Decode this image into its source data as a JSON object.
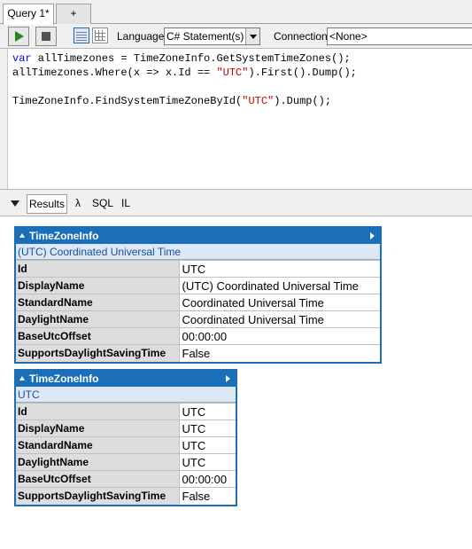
{
  "tabs": [
    {
      "label": "Query 1*",
      "active": true
    },
    {
      "label": "+"
    }
  ],
  "toolbar": {
    "run_icon": "play-icon",
    "stop_icon": "stop-icon",
    "language_label": "Language",
    "language_value": "C# Statement(s)",
    "connection_label": "Connection",
    "connection_value": "<None>"
  },
  "editor": {
    "lines": [
      "var allTimezones = TimeZoneInfo.GetSystemTimeZones();",
      "allTimezones.Where(x => x.Id == \"UTC\").First().Dump();",
      "",
      "TimeZoneInfo.FindSystemTimeZoneById(\"UTC\").Dump();"
    ]
  },
  "results_tabs": {
    "results": "Results",
    "lambda": "λ",
    "sql": "SQL",
    "il": "IL"
  },
  "dumps": [
    {
      "type": "TimeZoneInfo",
      "subtitle": "(UTC) Coordinated Universal Time",
      "rows": [
        {
          "key": "Id",
          "value": "UTC"
        },
        {
          "key": "DisplayName",
          "value": "(UTC) Coordinated Universal Time"
        },
        {
          "key": "StandardName",
          "value": "Coordinated Universal Time"
        },
        {
          "key": "DaylightName",
          "value": "Coordinated Universal Time"
        },
        {
          "key": "BaseUtcOffset",
          "value": "00:00:00"
        },
        {
          "key": "SupportsDaylightSavingTime",
          "value": "False"
        }
      ]
    },
    {
      "type": "TimeZoneInfo",
      "subtitle": "UTC",
      "rows": [
        {
          "key": "Id",
          "value": "UTC"
        },
        {
          "key": "DisplayName",
          "value": "UTC"
        },
        {
          "key": "StandardName",
          "value": "UTC"
        },
        {
          "key": "DaylightName",
          "value": "UTC"
        },
        {
          "key": "BaseUtcOffset",
          "value": "00:00:00"
        },
        {
          "key": "SupportsDaylightSavingTime",
          "value": "False"
        }
      ]
    }
  ],
  "colors": {
    "dump_header": "#1a6fb8",
    "keyword": "#0000ff",
    "string": "#c80000"
  }
}
